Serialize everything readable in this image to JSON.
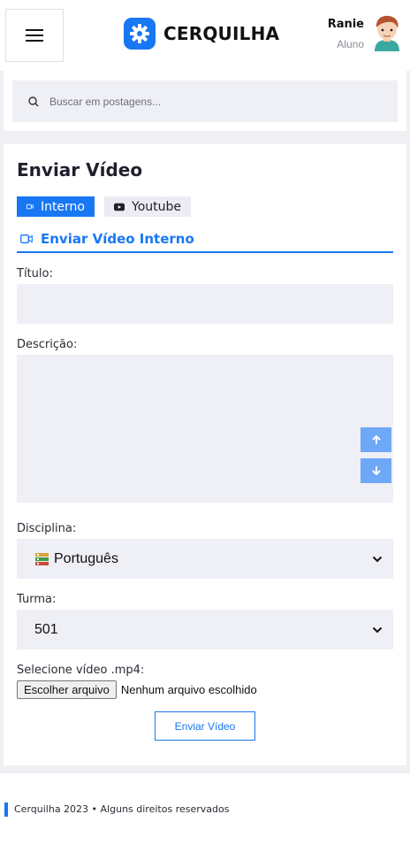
{
  "header": {
    "brand": "CERQUILHA",
    "user_name": "Ranie",
    "user_role": "Aluno",
    "brand_color": "#1877f2"
  },
  "search": {
    "placeholder": "Buscar em postagens..."
  },
  "form": {
    "title": "Enviar Vídeo",
    "tabs": [
      {
        "label": "Interno",
        "icon": "video-camera-icon",
        "active": true
      },
      {
        "label": "Youtube",
        "icon": "youtube-icon",
        "active": false
      }
    ],
    "section_title": "Enviar Vídeo Interno",
    "title_label": "Título:",
    "title_value": "",
    "description_label": "Descrição:",
    "description_value": "",
    "discipline_label": "Disciplina:",
    "discipline_selected": "Português",
    "discipline_icon": "books-icon",
    "class_label": "Turma:",
    "class_selected": "501",
    "file_label": "Selecione vídeo .mp4:",
    "file_button": "Escolher arquivo",
    "file_status": "Nenhum arquivo escolhido",
    "submit_label": "Enviar Vídeo"
  },
  "footer": {
    "text": "Cerquilha 2023 • Alguns direitos reservados"
  }
}
